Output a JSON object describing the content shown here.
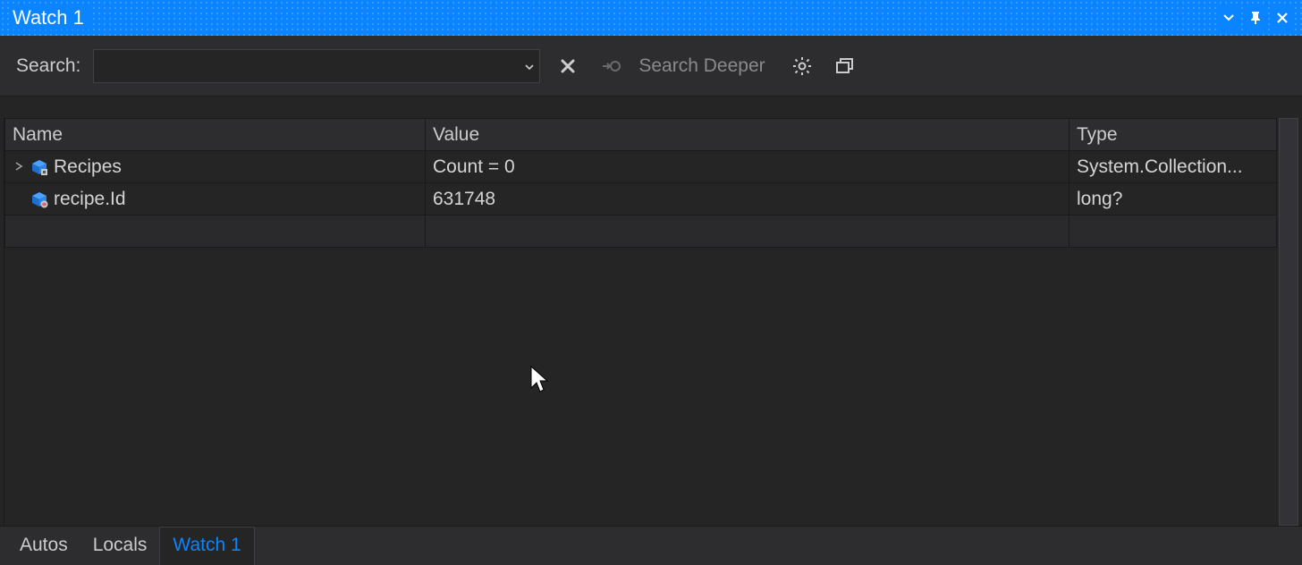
{
  "window": {
    "title": "Watch 1"
  },
  "toolbar": {
    "search_label": "Search:",
    "search_value": "",
    "search_deeper_label": "Search Deeper"
  },
  "columns": {
    "name": "Name",
    "value": "Value",
    "type": "Type"
  },
  "rows": [
    {
      "expandable": true,
      "icon": "cube-lock",
      "name": "Recipes",
      "value": "Count = 0",
      "type": "System.Collection..."
    },
    {
      "expandable": false,
      "icon": "cube-field",
      "name": "recipe.Id",
      "value": "631748",
      "type": "long?"
    }
  ],
  "tabs": [
    {
      "label": "Autos",
      "active": false
    },
    {
      "label": "Locals",
      "active": false
    },
    {
      "label": "Watch 1",
      "active": true
    }
  ]
}
